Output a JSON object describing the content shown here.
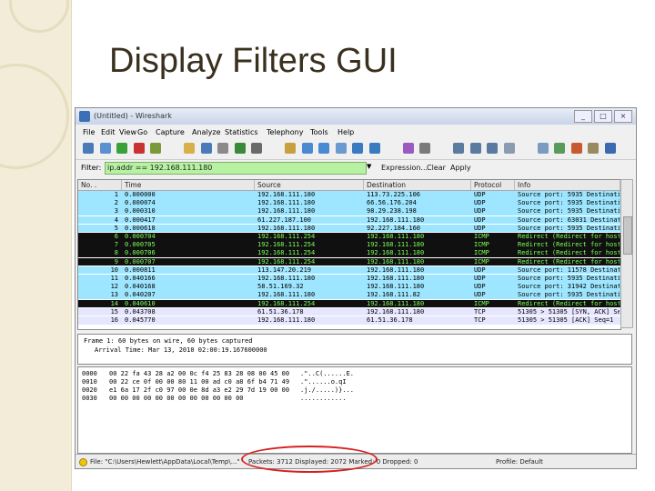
{
  "slide": {
    "title": "Display Filters GUI"
  },
  "window": {
    "title": "(Untitled) - Wireshark"
  },
  "menu": [
    "File",
    "Edit",
    "View",
    "Go",
    "Capture",
    "Analyze",
    "Statistics",
    "Telephony",
    "Tools",
    "Help"
  ],
  "toolbar": {
    "icons": [
      "interface-list-icon",
      "capture-options-icon",
      "start-capture-icon",
      "stop-capture-icon",
      "restart-capture-icon",
      "open-file-icon",
      "save-file-icon",
      "close-file-icon",
      "reload-icon",
      "print-icon",
      "find-packet-icon",
      "go-back-icon",
      "go-forward-icon",
      "go-to-packet-icon",
      "go-first-icon",
      "go-last-icon",
      "colorize-icon",
      "autoscroll-icon",
      "zoom-in-icon",
      "zoom-out-icon",
      "zoom-normal-icon",
      "resize-columns-icon",
      "capture-filters-icon",
      "display-filters-icon",
      "coloring-rules-icon",
      "preferences-icon",
      "help-icon"
    ],
    "colors": [
      "#4a7ab8",
      "#5a8fd0",
      "#3aa03a",
      "#c83232",
      "#7a9a3a",
      "#d8b04a",
      "#4a7ab8",
      "#8a8a8a",
      "#3a8a3a",
      "#6a6a6a",
      "#c8a040",
      "#4a8ad0",
      "#4a8ad0",
      "#6a9ad0",
      "#3a7ac0",
      "#3a7ac0",
      "#9a5ac0",
      "#7a7a7a",
      "#5a7aa0",
      "#5a7aa0",
      "#5a7aa0",
      "#8a9ab0",
      "#7a9ac0",
      "#5a9a5a",
      "#c85a30",
      "#9a8a60",
      "#3a6ab0"
    ]
  },
  "filter": {
    "label": "Filter:",
    "value": "ip.addr == 192.168.111.180",
    "expression": "Expression...",
    "clear": "Clear",
    "apply": "Apply"
  },
  "packet_list": {
    "columns": [
      "No. .",
      "Time",
      "Source",
      "Destination",
      "Protocol",
      "Info"
    ],
    "rows": [
      {
        "no": "1",
        "time": "0.000000",
        "src": "192.168.111.180",
        "dst": "113.73.225.106",
        "proto": "UDP",
        "info": "Source port: 5935  Destination port",
        "bg": "#9ee6ff",
        "fg": "#000000"
      },
      {
        "no": "2",
        "time": "0.000074",
        "src": "192.168.111.180",
        "dst": "66.56.176.204",
        "proto": "UDP",
        "info": "Source port: 5935  Destination port",
        "bg": "#9ee6ff",
        "fg": "#000000"
      },
      {
        "no": "3",
        "time": "0.000310",
        "src": "192.168.111.180",
        "dst": "98.29.238.198",
        "proto": "UDP",
        "info": "Source port: 5935  Destination port",
        "bg": "#9ee6ff",
        "fg": "#000000"
      },
      {
        "no": "4",
        "time": "0.000417",
        "src": "61.227.187.100",
        "dst": "192.168.111.180",
        "proto": "UDP",
        "info": "Source port: 63031  Destination port",
        "bg": "#9ee6ff",
        "fg": "#000000"
      },
      {
        "no": "5",
        "time": "0.000618",
        "src": "192.168.111.180",
        "dst": "92.227.184.160",
        "proto": "UDP",
        "info": "Source port: 5935  Destination port",
        "bg": "#9ee6ff",
        "fg": "#000000"
      },
      {
        "no": "6",
        "time": "0.000704",
        "src": "192.168.111.254",
        "dst": "192.168.111.180",
        "proto": "ICMP",
        "info": "Redirect  (Redirect for host)",
        "bg": "#101010",
        "fg": "#7dff5a"
      },
      {
        "no": "7",
        "time": "0.000705",
        "src": "192.168.111.254",
        "dst": "192.168.111.180",
        "proto": "ICMP",
        "info": "Redirect  (Redirect for host)",
        "bg": "#101010",
        "fg": "#7dff5a"
      },
      {
        "no": "8",
        "time": "0.000706",
        "src": "192.168.111.254",
        "dst": "192.168.111.180",
        "proto": "ICMP",
        "info": "Redirect  (Redirect for host)",
        "bg": "#101010",
        "fg": "#7dff5a"
      },
      {
        "no": "9",
        "time": "0.000707",
        "src": "192.168.111.254",
        "dst": "192.168.111.180",
        "proto": "ICMP",
        "info": "Redirect  (Redirect for host)",
        "bg": "#101010",
        "fg": "#7dff5a"
      },
      {
        "no": "10",
        "time": "0.000811",
        "src": "113.147.20.219",
        "dst": "192.168.111.180",
        "proto": "UDP",
        "info": "Source port: 11578  Destination port",
        "bg": "#9ee6ff",
        "fg": "#000000"
      },
      {
        "no": "11",
        "time": "0.040166",
        "src": "192.168.111.180",
        "dst": "192.168.111.180",
        "proto": "UDP",
        "info": "Source port: 5935  Destination port",
        "bg": "#9ee6ff",
        "fg": "#000000"
      },
      {
        "no": "12",
        "time": "0.040168",
        "src": "58.51.169.32",
        "dst": "192.168.111.180",
        "proto": "UDP",
        "info": "Source port: 31942  Destination port",
        "bg": "#9ee6ff",
        "fg": "#000000"
      },
      {
        "no": "13",
        "time": "0.040207",
        "src": "192.168.111.180",
        "dst": "192.168.111.82",
        "proto": "UDP",
        "info": "Source port: 5935  Destination port",
        "bg": "#9ee6ff",
        "fg": "#000000"
      },
      {
        "no": "14",
        "time": "0.040610",
        "src": "192.168.111.254",
        "dst": "192.168.111.180",
        "proto": "ICMP",
        "info": "Redirect  (Redirect for host)",
        "bg": "#101010",
        "fg": "#7dff5a"
      },
      {
        "no": "15",
        "time": "0.043708",
        "src": "61.51.36.178",
        "dst": "192.168.111.180",
        "proto": "TCP",
        "info": "51305 > 51305 [SYN, ACK] Seq=0",
        "bg": "#e6e6ff",
        "fg": "#000000"
      },
      {
        "no": "16",
        "time": "0.045770",
        "src": "192.168.111.180",
        "dst": "61.51.36.178",
        "proto": "TCP",
        "info": "51305 > 51305 [ACK] Seq=1",
        "bg": "#e6e6ff",
        "fg": "#000000"
      }
    ]
  },
  "details": [
    "Frame 1: 60 bytes on wire, 60 bytes captured",
    "Arrival Time: Mar 13, 2010 02:00:19.167600000"
  ],
  "hex": [
    {
      "off": "0000",
      "bytes": "00 22 fa 43 28 a2 00 0c  f4 25 83 28 08 00 45 00",
      "ascii": ".\"..C(......E."
    },
    {
      "off": "0010",
      "bytes": "00 22 ce 0f 00 00 80 11  00 ad c0 a8 6f b4 71 49",
      "ascii": ".\"......o.qI"
    },
    {
      "off": "0020",
      "bytes": "e1 6a 17 2f c0 97 00 0e  8d a3 e2 29 7d 19 00 00",
      "ascii": ".j./.....)}..."
    },
    {
      "off": "0030",
      "bytes": "00 00 00 00 00 00 00 00  00 00 00 00",
      "ascii": "............"
    }
  ],
  "status": {
    "path": "File: \"C:\\Users\\Hewlett\\AppData\\Local\\Temp\\...\"",
    "packets": "Packets: 3712 Displayed: 2072 Marked: 0 Dropped: 0",
    "profile": "Profile: Default"
  }
}
